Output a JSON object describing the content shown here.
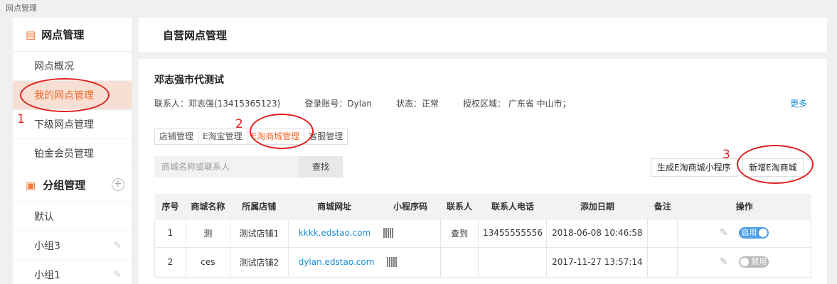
{
  "breadcrumb": "网点管理",
  "sidebar": {
    "section1": "网点管理",
    "items": [
      {
        "label": "网点概况"
      },
      {
        "label": "我的网点管理"
      },
      {
        "label": "下级网点管理"
      },
      {
        "label": "铂金会员管理"
      }
    ],
    "section2": "分组管理",
    "groups": [
      {
        "label": "默认"
      },
      {
        "label": "小组3"
      },
      {
        "label": "小组1"
      }
    ]
  },
  "main": {
    "header": "自营网点管理",
    "title": "邓志强市代测试",
    "info": {
      "contact": "联系人：邓志强(13415365123)",
      "account": "登录账号：Dylan",
      "status": "状态：正常",
      "region": "授权区域： 广东省 中山市；",
      "more": "更多"
    },
    "tabs": [
      "店铺管理",
      "E淘宝管理",
      "E淘商城管理",
      "客服管理"
    ],
    "search_placeholder": "商城名称或联系人",
    "find_label": "查找",
    "gen_button": "生成E淘商城小程序",
    "add_button": "新增E淘商城",
    "columns": [
      "序号",
      "商城名称",
      "所属店铺",
      "商城网址",
      "小程序码",
      "联系人",
      "联系人电话",
      "添加日期",
      "备注",
      "操作"
    ],
    "rows": [
      {
        "no": "1",
        "name": "测",
        "shop": "测试店铺1",
        "url": "kkkk.edstao.com",
        "contact": "查到",
        "phone": "13455555556",
        "date": "2018-06-08 10:46:58",
        "note": "",
        "toggle": "启用"
      },
      {
        "no": "2",
        "name": "ces",
        "shop": "测试店铺2",
        "url": "dylan.edstao.com",
        "contact": "",
        "phone": "",
        "date": "2017-11-27 13:57:14",
        "note": "",
        "toggle": "禁用"
      }
    ]
  },
  "annotations": [
    "1",
    "2",
    "3"
  ],
  "colors": {
    "accent": "#f06a2a",
    "link": "#1a8bd6",
    "annotation": "#e12020"
  }
}
